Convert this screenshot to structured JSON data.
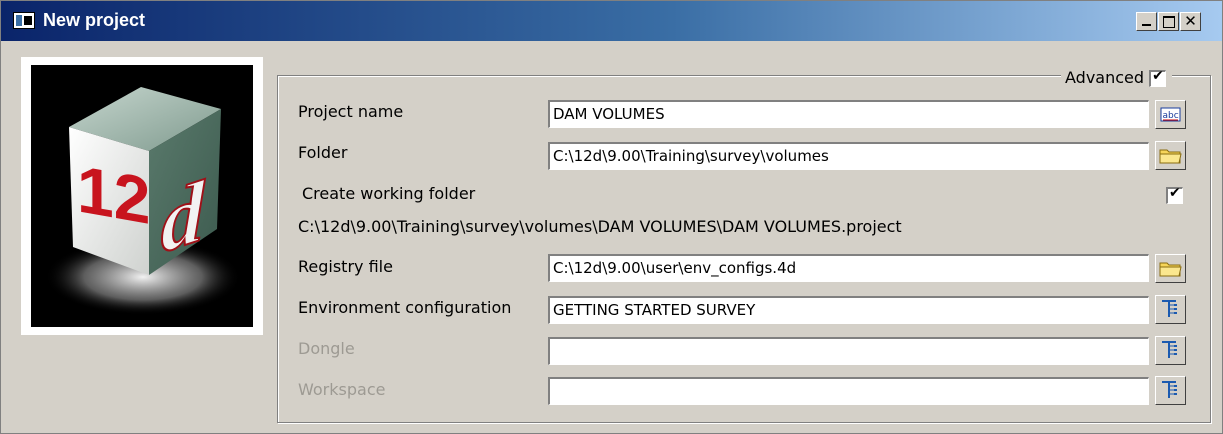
{
  "window": {
    "title": "New project"
  },
  "logo": {
    "text_number": "12",
    "text_letter": "d"
  },
  "advanced": {
    "label": "Advanced",
    "checked": true
  },
  "fields": {
    "project_name": {
      "label": "Project name",
      "value": "DAM VOLUMES",
      "button_icon": "spellcheck-icon"
    },
    "folder": {
      "label": "Folder",
      "value": "C:\\12d\\9.00\\Training\\survey\\volumes",
      "button_icon": "folder-icon"
    },
    "create_working_folder": {
      "label": "Create working folder",
      "checked": true
    },
    "project_path": "C:\\12d\\9.00\\Training\\survey\\volumes\\DAM VOLUMES\\DAM VOLUMES.project",
    "registry_file": {
      "label": "Registry file",
      "value": "C:\\12d\\9.00\\user\\env_configs.4d",
      "button_icon": "folder-icon"
    },
    "environment_configuration": {
      "label": "Environment configuration",
      "value": "GETTING STARTED SURVEY",
      "button_icon": "tree-list-icon"
    },
    "dongle": {
      "label": "Dongle",
      "value": "",
      "button_icon": "tree-list-icon",
      "disabled": true
    },
    "workspace": {
      "label": "Workspace",
      "value": "",
      "button_icon": "tree-list-icon",
      "disabled": true
    }
  }
}
